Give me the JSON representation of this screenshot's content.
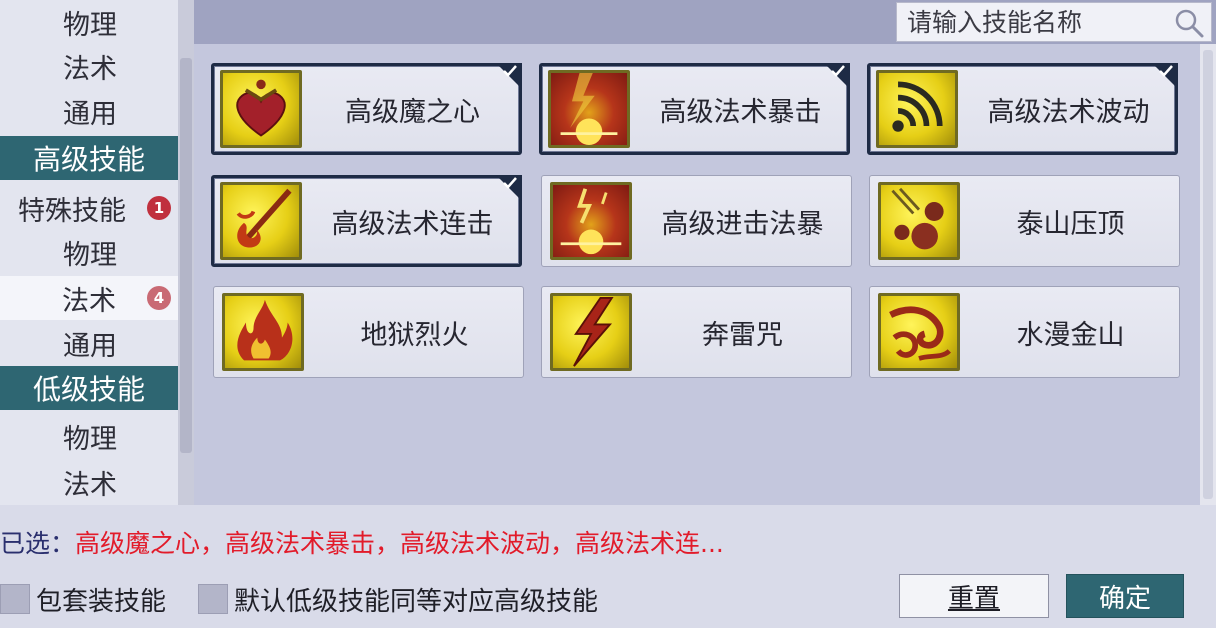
{
  "sidebar": {
    "items": [
      {
        "label": "物理",
        "type": "sub"
      },
      {
        "label": "法术",
        "type": "sub"
      },
      {
        "label": "通用",
        "type": "sub"
      },
      {
        "label": "高级技能",
        "type": "header"
      },
      {
        "label": "特殊技能",
        "type": "special",
        "badge": "1"
      },
      {
        "label": "物理",
        "type": "sub"
      },
      {
        "label": "法术",
        "type": "selected",
        "badge": "4"
      },
      {
        "label": "通用",
        "type": "sub"
      },
      {
        "label": "低级技能",
        "type": "header"
      },
      {
        "label": "物理",
        "type": "sub"
      },
      {
        "label": "法术",
        "type": "sub"
      }
    ]
  },
  "search": {
    "placeholder": "请输入技能名称"
  },
  "skills": [
    {
      "name": "高级魔之心",
      "checked": true,
      "icon": "heart-icon"
    },
    {
      "name": "高级法术暴击",
      "checked": true,
      "icon": "burst-icon"
    },
    {
      "name": "高级法术波动",
      "checked": true,
      "icon": "wave-icon"
    },
    {
      "name": "高级法术连击",
      "checked": true,
      "icon": "flame-strike-icon"
    },
    {
      "name": "高级进击法暴",
      "checked": false,
      "icon": "explosion-icon"
    },
    {
      "name": "泰山压顶",
      "checked": false,
      "icon": "rocks-icon"
    },
    {
      "name": "地狱烈火",
      "checked": false,
      "icon": "fire-icon"
    },
    {
      "name": "奔雷咒",
      "checked": false,
      "icon": "lightning-icon"
    },
    {
      "name": "水漫金山",
      "checked": false,
      "icon": "water-icon"
    }
  ],
  "footer": {
    "selected_label": "已选：",
    "selected_value": "高级魔之心，高级法术暴击，高级法术波动，高级法术连...",
    "option1": "包套装技能",
    "option2": "默认低级技能同等对应高级技能",
    "reset_label": "重置",
    "ok_label": "确定"
  },
  "colors": {
    "header_bg": "#2e6672",
    "selected_text": "#e21b2a",
    "badge": "#c0303e"
  }
}
